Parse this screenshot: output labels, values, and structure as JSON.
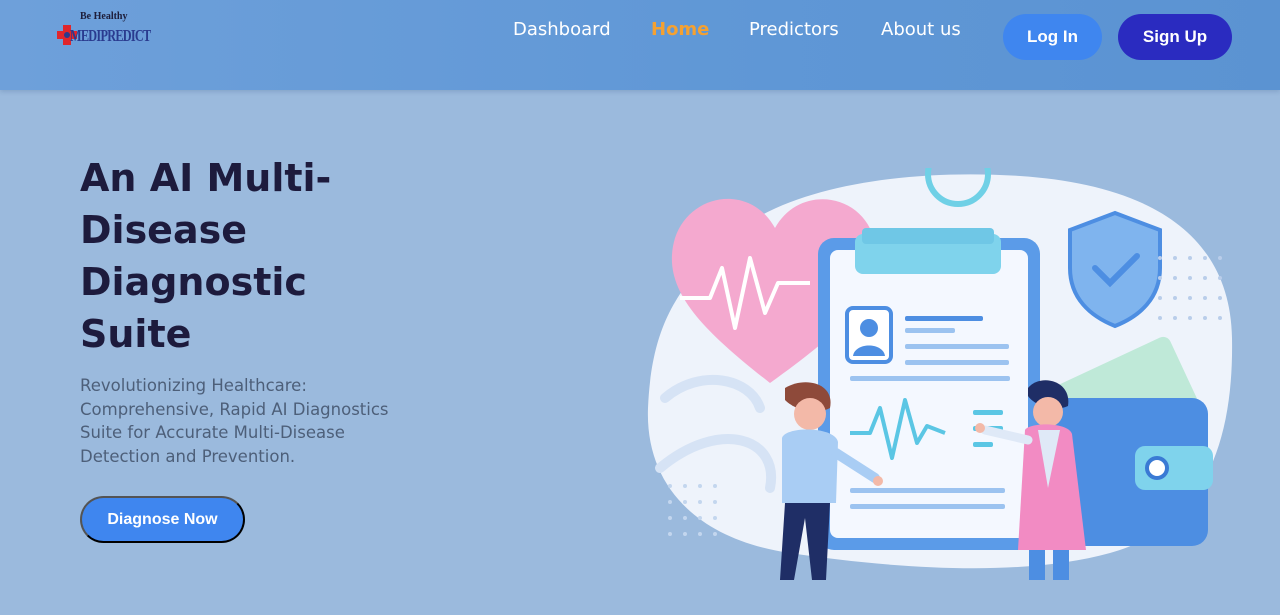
{
  "brand": {
    "tagline": "Be Healthy",
    "name": "MEDIPREDICT",
    "icon": "medical-cross-icon",
    "colors": {
      "cross": "#e0262c",
      "wordmark": "#2a3b8f"
    }
  },
  "nav": {
    "links": [
      {
        "label": "Dashboard",
        "active": false
      },
      {
        "label": "Home",
        "active": true
      },
      {
        "label": "Predictors",
        "active": false
      },
      {
        "label": "About us",
        "active": false
      }
    ],
    "login_label": "Log In",
    "signup_label": "Sign Up"
  },
  "hero": {
    "title": "An AI Multi-Disease Diagnostic Suite",
    "subtitle": "Revolutionizing Healthcare: Comprehensive, Rapid AI Diagnostics Suite for Accurate Multi-Disease Detection and Prevention.",
    "cta_label": "Diagnose Now",
    "illustration": {
      "icons": [
        "heart-icon",
        "clipboard-icon",
        "shield-check-icon",
        "wallet-icon",
        "doctor-icon",
        "patient-icon",
        "clock-icon"
      ]
    }
  },
  "colors": {
    "background": "#9bbadd",
    "nav_bg": "#6ea0da",
    "accent_active": "#f5a131",
    "primary_button": "#3f86ef",
    "signup_button": "#2a2bc0",
    "title": "#1d1b3d"
  }
}
